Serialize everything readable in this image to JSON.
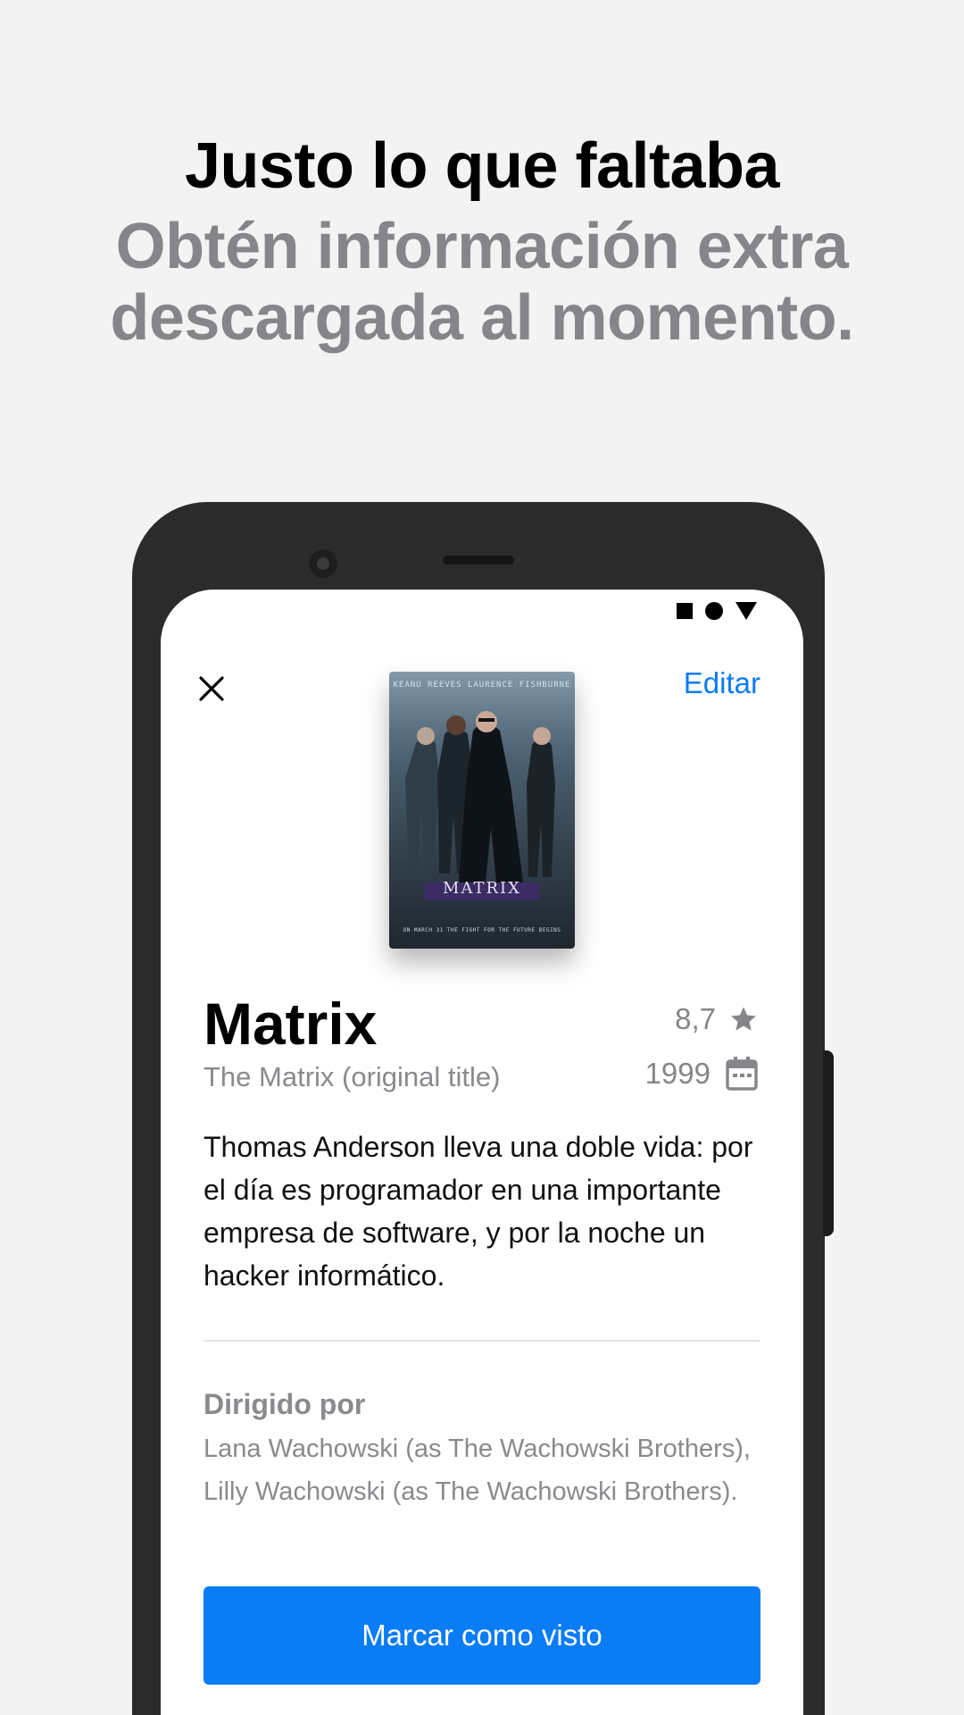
{
  "hero": {
    "title": "Justo lo que faltaba",
    "subtitle_line1": "Obtén información extra",
    "subtitle_line2": "descargada al momento."
  },
  "toolbar": {
    "close_icon": "close-icon",
    "edit_label": "Editar"
  },
  "poster": {
    "actors": "KEANU REEVES   LAURENCE FISHBURNE",
    "title": "MATRIX",
    "tagline": "ON MARCH 31 THE FIGHT FOR THE FUTURE BEGINS"
  },
  "movie": {
    "title": "Matrix",
    "original_title": "The Matrix (original title)",
    "rating": "8,7",
    "year": "1999",
    "synopsis": "Thomas Anderson lleva una doble vida: por el día es programador en una importante empresa de software, y por la noche un hacker informático.",
    "director_label": "Dirigido por",
    "director_names": "Lana Wachowski (as The Wachowski Brothers), Lilly Wachowski (as The Wachowski Brothers)."
  },
  "actions": {
    "mark_watched": "Marcar como visto"
  },
  "colors": {
    "accent": "#0a7cf5",
    "muted_text": "#86868a",
    "background": "#f3f3f3",
    "phone_frame": "#2b2b2b"
  }
}
